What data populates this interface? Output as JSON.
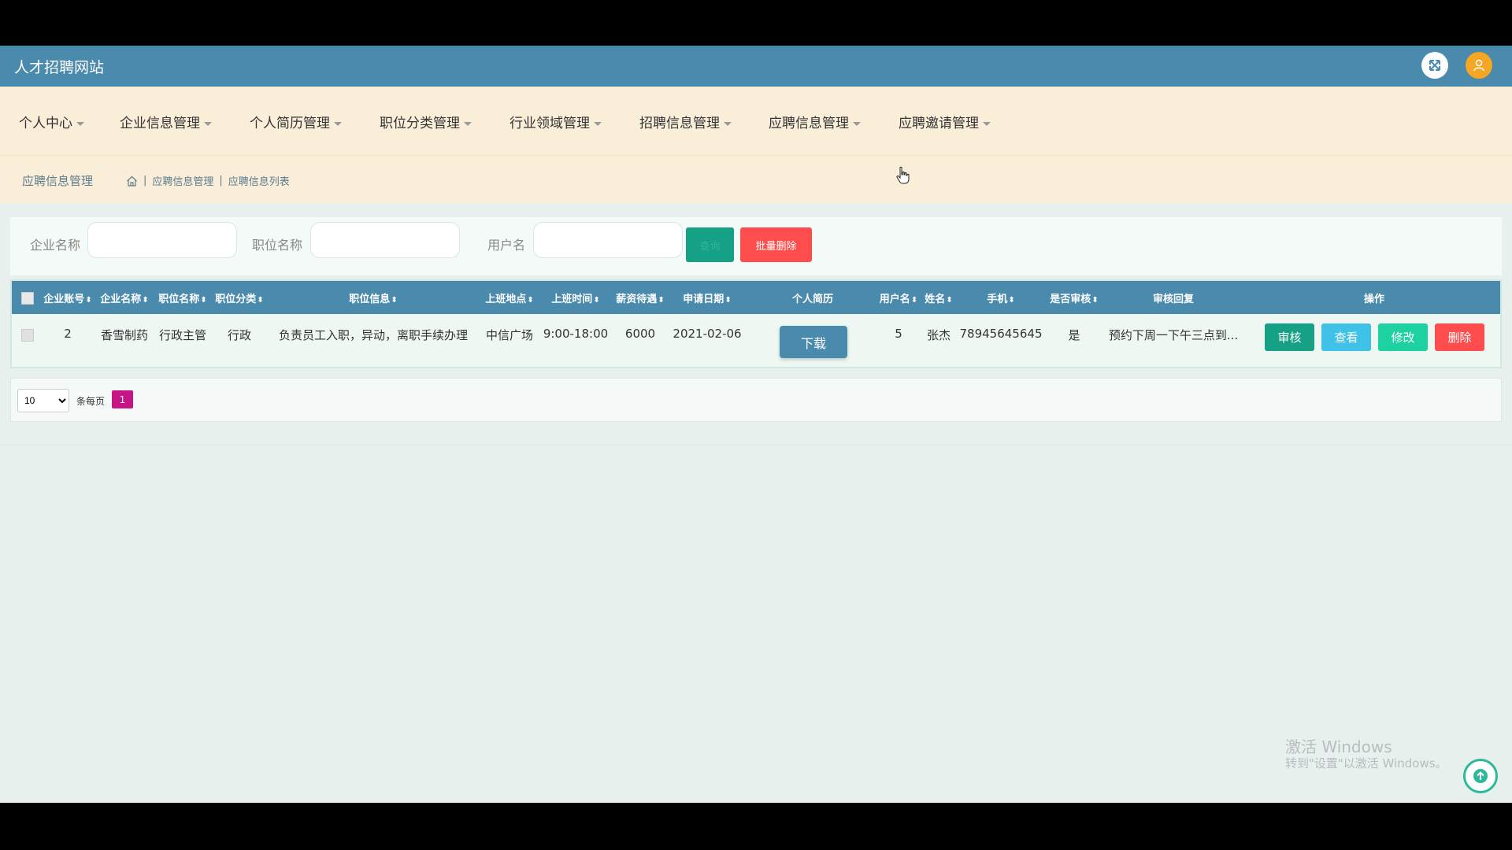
{
  "app": {
    "title": "人才招聘网站"
  },
  "header_icons": {
    "expand": "fullscreen-icon",
    "avatar": "user-avatar-icon"
  },
  "nav": [
    {
      "label": "个人中心"
    },
    {
      "label": "企业信息管理"
    },
    {
      "label": "个人简历管理"
    },
    {
      "label": "职位分类管理"
    },
    {
      "label": "行业领域管理"
    },
    {
      "label": "招聘信息管理"
    },
    {
      "label": "应聘信息管理"
    },
    {
      "label": "应聘邀请管理"
    }
  ],
  "breadcrumb": {
    "title": "应聘信息管理",
    "path": [
      "应聘信息管理",
      "应聘信息列表"
    ]
  },
  "search": {
    "company_label": "企业名称",
    "company_value": "",
    "position_label": "职位名称",
    "position_value": "",
    "username_label": "用户名",
    "username_value": "",
    "search_button": "查询",
    "batch_delete_button": "批量删除"
  },
  "table": {
    "columns": [
      "企业账号",
      "企业名称",
      "职位名称",
      "职位分类",
      "职位信息",
      "上班地点",
      "上班时间",
      "薪资待遇",
      "申请日期",
      "个人简历",
      "用户名",
      "姓名",
      "手机",
      "是否审核",
      "审核回复",
      "操作"
    ],
    "rows": [
      {
        "company_account": "2",
        "company_name": "香雪制药",
        "position_name": "行政主管",
        "position_category": "行政",
        "position_info": "负责员工入职，异动，离职手续办理",
        "work_location": "中信广场",
        "work_hours": "9:00-18:00",
        "salary": "6000",
        "apply_date": "2021-02-06",
        "resume_button": "下载",
        "username": "5",
        "name": "张杰",
        "phone": "78945645645",
        "reviewed": "是",
        "review_reply": "预约下周一下午三点到...",
        "actions": {
          "review": "审核",
          "view": "查看",
          "edit": "修改",
          "delete": "删除"
        }
      }
    ]
  },
  "pagination": {
    "page_size": "10",
    "per_page_label": "条每页",
    "current_page": "1"
  },
  "watermark": {
    "title": "激活 Windows",
    "subtitle": "转到\"设置\"以激活 Windows。"
  },
  "colors": {
    "header": "#4a8aad",
    "nav_bg": "#fbeed9",
    "review": "#16a085",
    "view": "#3fc1e8",
    "edit": "#1dd1a1",
    "delete": "#ff4d4d",
    "page_active": "#c71585"
  }
}
